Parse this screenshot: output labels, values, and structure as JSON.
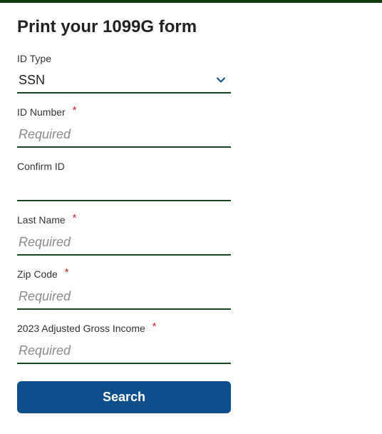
{
  "title": "Print your 1099G form",
  "fields": {
    "idType": {
      "label": "ID Type",
      "value": "SSN"
    },
    "idNumber": {
      "label": "ID Number",
      "placeholder": "Required",
      "required": true
    },
    "confirmId": {
      "label": "Confirm ID",
      "placeholder": ""
    },
    "lastName": {
      "label": "Last Name",
      "placeholder": "Required",
      "required": true
    },
    "zipCode": {
      "label": "Zip Code",
      "placeholder": "Required",
      "required": true
    },
    "agi": {
      "label": "2023 Adjusted Gross Income",
      "placeholder": "Required",
      "required": true
    }
  },
  "buttons": {
    "search": "Search"
  },
  "requiredMark": "*",
  "colors": {
    "accentBorder": "#1a4720",
    "primaryButton": "#0d4f8b",
    "requiredStar": "#c62828"
  }
}
